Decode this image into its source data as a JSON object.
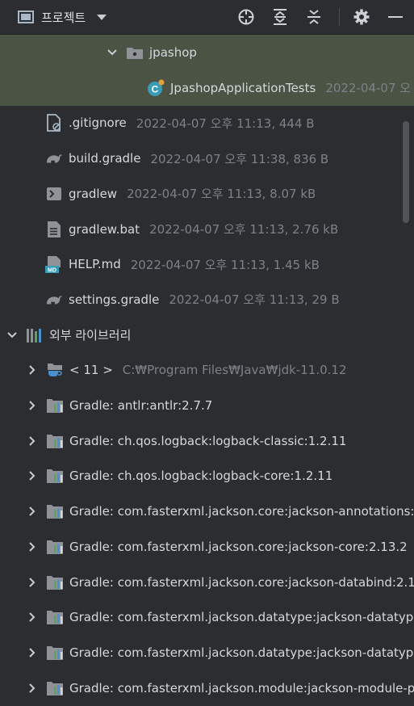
{
  "header": {
    "title": "프로젝트"
  },
  "tree": [
    {
      "id": "jpashop-folder",
      "label": "jpashop",
      "meta": "",
      "icon": "folder-icon",
      "chevron": "down"
    },
    {
      "id": "jpashop-tests",
      "label": "JpashopApplicationTests",
      "meta": "2022-04-07 오",
      "icon": "test-class-icon",
      "chevron": ""
    },
    {
      "id": "gitignore",
      "label": ".gitignore",
      "meta": "2022-04-07 오후 11:13, 444 B",
      "icon": "ignore-file-icon",
      "chevron": ""
    },
    {
      "id": "build-gradle",
      "label": "build.gradle",
      "meta": "2022-04-07 오후 11:38, 836 B",
      "icon": "gradle-icon",
      "chevron": ""
    },
    {
      "id": "gradlew",
      "label": "gradlew",
      "meta": "2022-04-07 오후 11:13, 8.07 kB",
      "icon": "terminal-icon",
      "chevron": ""
    },
    {
      "id": "gradlew-bat",
      "label": "gradlew.bat",
      "meta": "2022-04-07 오후 11:13, 2.76 kB",
      "icon": "text-file-icon",
      "chevron": ""
    },
    {
      "id": "help-md",
      "label": "HELP.md",
      "meta": "2022-04-07 오후 11:13, 1.45 kB",
      "icon": "markdown-icon",
      "chevron": ""
    },
    {
      "id": "settings-gradle",
      "label": "settings.gradle",
      "meta": "2022-04-07 오후 11:13, 29 B",
      "icon": "gradle-icon",
      "chevron": ""
    },
    {
      "id": "external-libraries",
      "label": "외부 라이브러리",
      "meta": "",
      "icon": "library-icon",
      "chevron": "down"
    },
    {
      "id": "jdk-11",
      "label": "< 11 >",
      "meta": "C:₩Program Files₩Java₩jdk-11.0.12",
      "icon": "jdk-icon",
      "chevron": "right"
    },
    {
      "id": "antlr",
      "label": "Gradle: antlr:antlr:2.7.7",
      "meta": "",
      "icon": "gradle-library-icon",
      "chevron": "right"
    },
    {
      "id": "logback-classic",
      "label": "Gradle: ch.qos.logback:logback-classic:1.2.11",
      "meta": "",
      "icon": "gradle-library-icon",
      "chevron": "right"
    },
    {
      "id": "logback-core",
      "label": "Gradle: ch.qos.logback:logback-core:1.2.11",
      "meta": "",
      "icon": "gradle-library-icon",
      "chevron": "right"
    },
    {
      "id": "jackson-annotations",
      "label": "Gradle: com.fasterxml.jackson.core:jackson-annotations:",
      "meta": "",
      "icon": "gradle-library-icon",
      "chevron": "right"
    },
    {
      "id": "jackson-core",
      "label": "Gradle: com.fasterxml.jackson.core:jackson-core:2.13.2",
      "meta": "",
      "icon": "gradle-library-icon",
      "chevron": "right"
    },
    {
      "id": "jackson-databind",
      "label": "Gradle: com.fasterxml.jackson.core:jackson-databind:2.1",
      "meta": "",
      "icon": "gradle-library-icon",
      "chevron": "right"
    },
    {
      "id": "jackson-datatype-1",
      "label": "Gradle: com.fasterxml.jackson.datatype:jackson-datatyp",
      "meta": "",
      "icon": "gradle-library-icon",
      "chevron": "right"
    },
    {
      "id": "jackson-datatype-2",
      "label": "Gradle: com.fasterxml.jackson.datatype:jackson-datatyp",
      "meta": "",
      "icon": "gradle-library-icon",
      "chevron": "right"
    },
    {
      "id": "jackson-module",
      "label": "Gradle: com.fasterxml.jackson.module:jackson-module-p",
      "meta": "",
      "icon": "gradle-library-icon",
      "chevron": "right"
    }
  ],
  "colors": {
    "background": "#2b2d30",
    "selected": "#4b5344",
    "text": "#d6d8dc",
    "meta": "#7e8187"
  }
}
